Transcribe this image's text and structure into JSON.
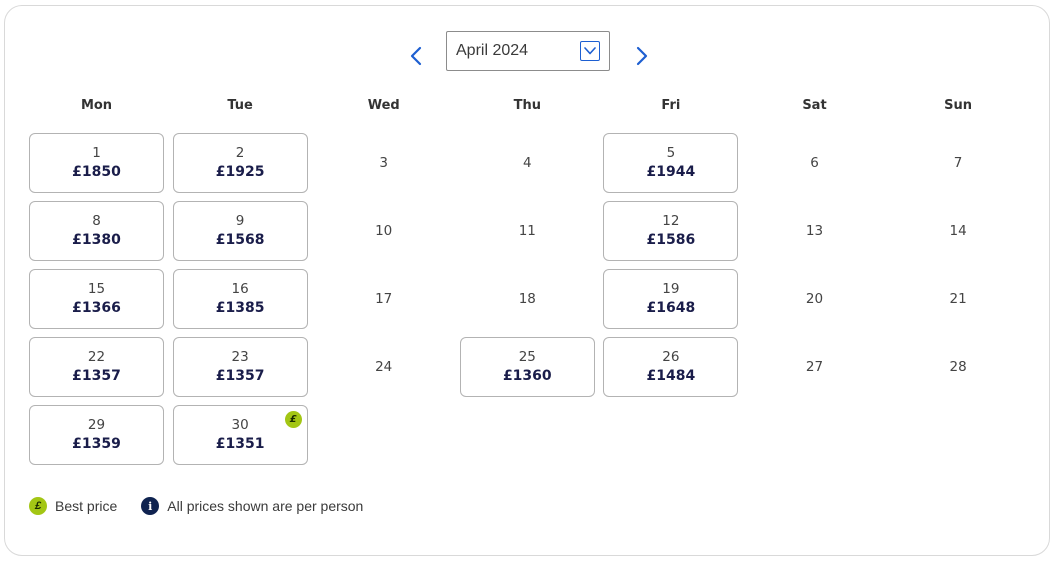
{
  "calendar": {
    "month_label": "April 2024",
    "weekdays": [
      "Mon",
      "Tue",
      "Wed",
      "Thu",
      "Fri",
      "Sat",
      "Sun"
    ],
    "days": [
      {
        "day": "1",
        "price": "£1850",
        "best": false
      },
      {
        "day": "2",
        "price": "£1925",
        "best": false
      },
      {
        "day": "3",
        "price": null,
        "best": false
      },
      {
        "day": "4",
        "price": null,
        "best": false
      },
      {
        "day": "5",
        "price": "£1944",
        "best": false
      },
      {
        "day": "6",
        "price": null,
        "best": false
      },
      {
        "day": "7",
        "price": null,
        "best": false
      },
      {
        "day": "8",
        "price": "£1380",
        "best": false
      },
      {
        "day": "9",
        "price": "£1568",
        "best": false
      },
      {
        "day": "10",
        "price": null,
        "best": false
      },
      {
        "day": "11",
        "price": null,
        "best": false
      },
      {
        "day": "12",
        "price": "£1586",
        "best": false
      },
      {
        "day": "13",
        "price": null,
        "best": false
      },
      {
        "day": "14",
        "price": null,
        "best": false
      },
      {
        "day": "15",
        "price": "£1366",
        "best": false
      },
      {
        "day": "16",
        "price": "£1385",
        "best": false
      },
      {
        "day": "17",
        "price": null,
        "best": false
      },
      {
        "day": "18",
        "price": null,
        "best": false
      },
      {
        "day": "19",
        "price": "£1648",
        "best": false
      },
      {
        "day": "20",
        "price": null,
        "best": false
      },
      {
        "day": "21",
        "price": null,
        "best": false
      },
      {
        "day": "22",
        "price": "£1357",
        "best": false
      },
      {
        "day": "23",
        "price": "£1357",
        "best": false
      },
      {
        "day": "24",
        "price": null,
        "best": false
      },
      {
        "day": "25",
        "price": "£1360",
        "best": false
      },
      {
        "day": "26",
        "price": "£1484",
        "best": false
      },
      {
        "day": "27",
        "price": null,
        "best": false
      },
      {
        "day": "28",
        "price": null,
        "best": false
      },
      {
        "day": "29",
        "price": "£1359",
        "best": false
      },
      {
        "day": "30",
        "price": "£1351",
        "best": true
      }
    ],
    "best_badge_symbol": "£"
  },
  "legend": {
    "best_price_symbol": "£",
    "best_price_label": "Best price",
    "info_symbol": "i",
    "info_label": "All prices shown are per person"
  },
  "colors": {
    "accent": "#1d5fd1",
    "best_price": "#a3c614",
    "price_text": "#1a1d4a",
    "info_dot": "#0f2350"
  }
}
